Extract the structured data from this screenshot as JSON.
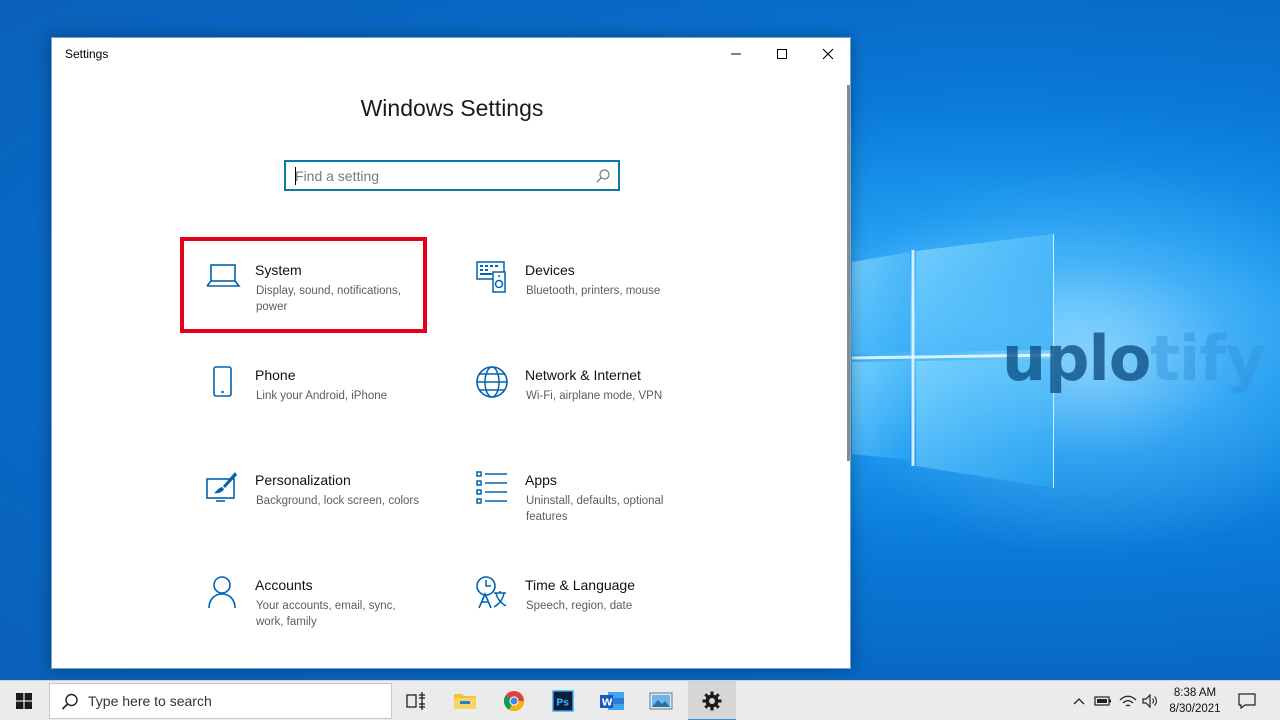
{
  "window": {
    "title": "Settings",
    "page_title": "Windows Settings"
  },
  "search": {
    "placeholder": "Find a setting"
  },
  "tiles": [
    {
      "name": "System",
      "desc": "Display, sound, notifications, power",
      "icon": "laptop-icon"
    },
    {
      "name": "Devices",
      "desc": "Bluetooth, printers, mouse",
      "icon": "devices-icon"
    },
    {
      "name": "Phone",
      "desc": "Link your Android, iPhone",
      "icon": "phone-icon"
    },
    {
      "name": "Network & Internet",
      "desc": "Wi-Fi, airplane mode, VPN",
      "icon": "globe-icon"
    },
    {
      "name": "Personalization",
      "desc": "Background, lock screen, colors",
      "icon": "paint-icon"
    },
    {
      "name": "Apps",
      "desc": "Uninstall, defaults, optional features",
      "icon": "apps-list-icon"
    },
    {
      "name": "Accounts",
      "desc": "Your accounts, email, sync, work, family",
      "icon": "person-icon"
    },
    {
      "name": "Time & Language",
      "desc": "Speech, region, date",
      "icon": "time-language-icon"
    }
  ],
  "watermark": {
    "bold": "uplo",
    "light": "tify"
  },
  "taskbar": {
    "search_text": "Type here to search",
    "time": "8:38 AM",
    "date": "8/30/2021"
  },
  "colors": {
    "accent": "#0a7aa8",
    "icon_blue": "#0063b1",
    "highlight": "#e3001b"
  }
}
